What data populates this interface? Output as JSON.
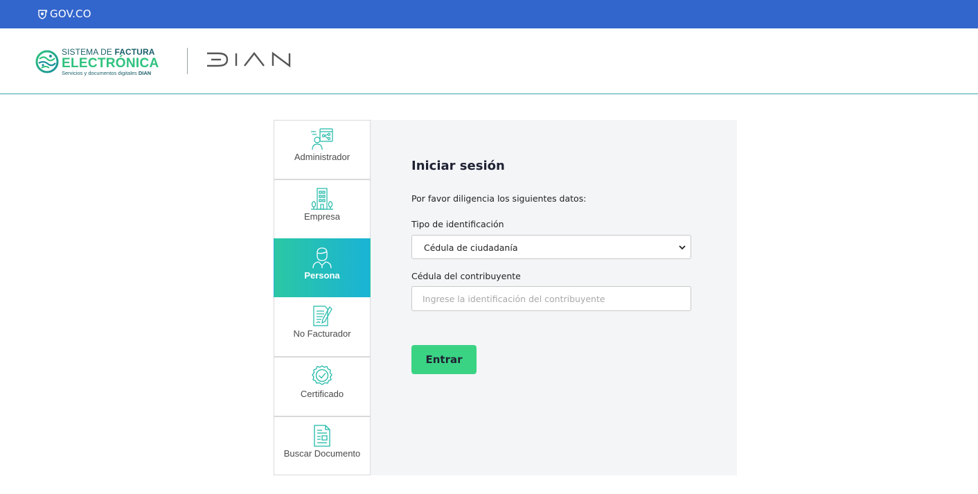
{
  "gov_bar": {
    "logo_text": "GOV.CO",
    "color": "#3366cc"
  },
  "brand": {
    "line1_prefix": "SISTEMA DE ",
    "line1_bold": "FACTURA",
    "line2": "ELECTRÓNICA",
    "line3_prefix": "Servicios y documentos digitales ",
    "line3_bold": "DIAN",
    "partner_logo": "DIAN"
  },
  "tabs": [
    {
      "label": "Administrador",
      "icon": "admin-network-icon"
    },
    {
      "label": "Empresa",
      "icon": "building-icon"
    },
    {
      "label": "Persona",
      "icon": "person-icon",
      "active": true
    },
    {
      "label": "No Facturador",
      "icon": "document-pen-icon"
    },
    {
      "label": "Certificado",
      "icon": "certificate-badge-icon"
    },
    {
      "label": "Buscar Documento",
      "icon": "document-search-icon"
    }
  ],
  "form": {
    "title": "Iniciar sesión",
    "subtitle": "Por favor diligencia los siguientes datos:",
    "id_type_label": "Tipo de identificación",
    "id_type_value": "Cédula de ciudadanía",
    "id_number_label": "Cédula del contribuyente",
    "id_number_placeholder": "Ingrese la identificación del contribuyente",
    "submit_label": "Entrar"
  },
  "colors": {
    "accent_green": "#3ad384",
    "active_tab_start": "#2bc7a4",
    "active_tab_end": "#1ab3d6",
    "underline_orange": "#f0803c",
    "header_border": "#3aa3a7"
  }
}
